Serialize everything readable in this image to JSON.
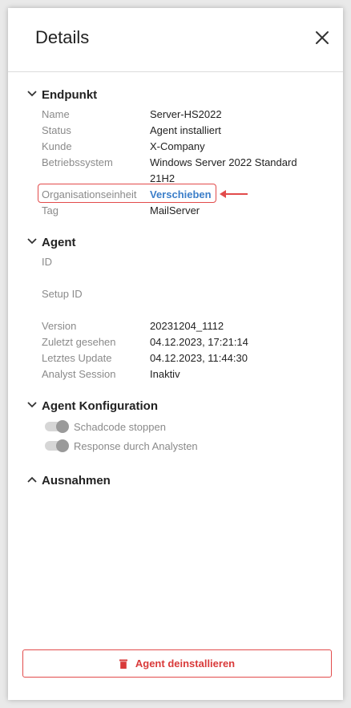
{
  "header": {
    "title": "Details"
  },
  "endpoint": {
    "heading": "Endpunkt",
    "rows": [
      {
        "label": "Name",
        "value": "Server-HS2022"
      },
      {
        "label": "Status",
        "value": "Agent installiert"
      },
      {
        "label": "Kunde",
        "value": "X-Company"
      },
      {
        "label": "Betriebssystem",
        "value": "Windows Server 2022 Standard",
        "value2": "21H2"
      },
      {
        "label": "Organisationseinheit",
        "link": "Verschieben"
      },
      {
        "label": "Tag",
        "value": "MailServer"
      }
    ]
  },
  "agent": {
    "heading": "Agent",
    "rows": [
      {
        "label": "ID",
        "value": ""
      },
      {
        "label": "Setup ID",
        "value": ""
      },
      {
        "label": "Version",
        "value": "20231204_1112"
      },
      {
        "label": "Zuletzt gesehen",
        "value": "04.12.2023, 17:21:14"
      },
      {
        "label": "Letztes Update",
        "value": "04.12.2023, 11:44:30"
      },
      {
        "label": "Analyst Session",
        "value": "Inaktiv"
      }
    ]
  },
  "agent_config": {
    "heading": "Agent Konfiguration",
    "toggles": [
      {
        "label": "Schadcode stoppen",
        "state": "on-disabled"
      },
      {
        "label": "Response durch Analysten",
        "state": "on-disabled"
      }
    ]
  },
  "exceptions": {
    "heading": "Ausnahmen"
  },
  "footer": {
    "uninstall_label": "Agent deinstallieren"
  },
  "colors": {
    "accent_link": "#3b7ec9",
    "danger": "#d93a3a",
    "highlight": "#e24b4b"
  }
}
